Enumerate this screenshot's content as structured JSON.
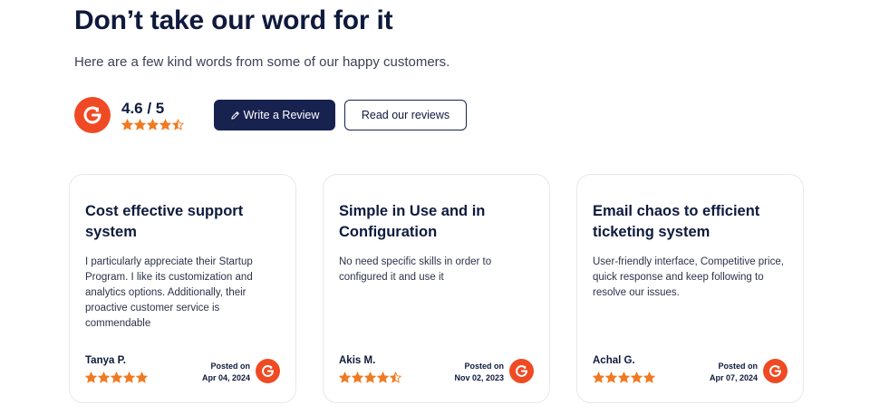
{
  "header": {
    "title": "Don’t take our word for it",
    "subtitle": "Here are a few kind words from some of our happy customers."
  },
  "rating": {
    "score": "4.6 / 5",
    "stars": 4.5,
    "badge_icon": "g2-logo"
  },
  "actions": {
    "write_review_label": "Write a Review",
    "write_review_icon": "pencil-icon",
    "read_reviews_label": "Read our reviews"
  },
  "colors": {
    "brand_navy": "#18224f",
    "g2_red": "#ef4a24",
    "star_orange": "#f07a22"
  },
  "reviews": [
    {
      "title": "Cost effective support system",
      "body": "I particularly appreciate their Startup Program. I like its customization and analytics options. Additionally, their proactive customer service is commendable",
      "author": "Tanya P.",
      "stars": 5,
      "posted_label": "Posted on",
      "date": "Apr 04, 2024"
    },
    {
      "title": "Simple in Use and in Configuration",
      "body": "No need specific skills in order to configured it and use it",
      "author": "Akis M.",
      "stars": 4.5,
      "posted_label": "Posted on",
      "date": "Nov 02, 2023"
    },
    {
      "title": "Email chaos to efficient ticketing system",
      "body": "User-friendly interface, Competitive price, quick response and keep following to resolve our issues.",
      "author": "Achal G.",
      "stars": 5,
      "posted_label": "Posted on",
      "date": "Apr 07, 2024"
    }
  ]
}
